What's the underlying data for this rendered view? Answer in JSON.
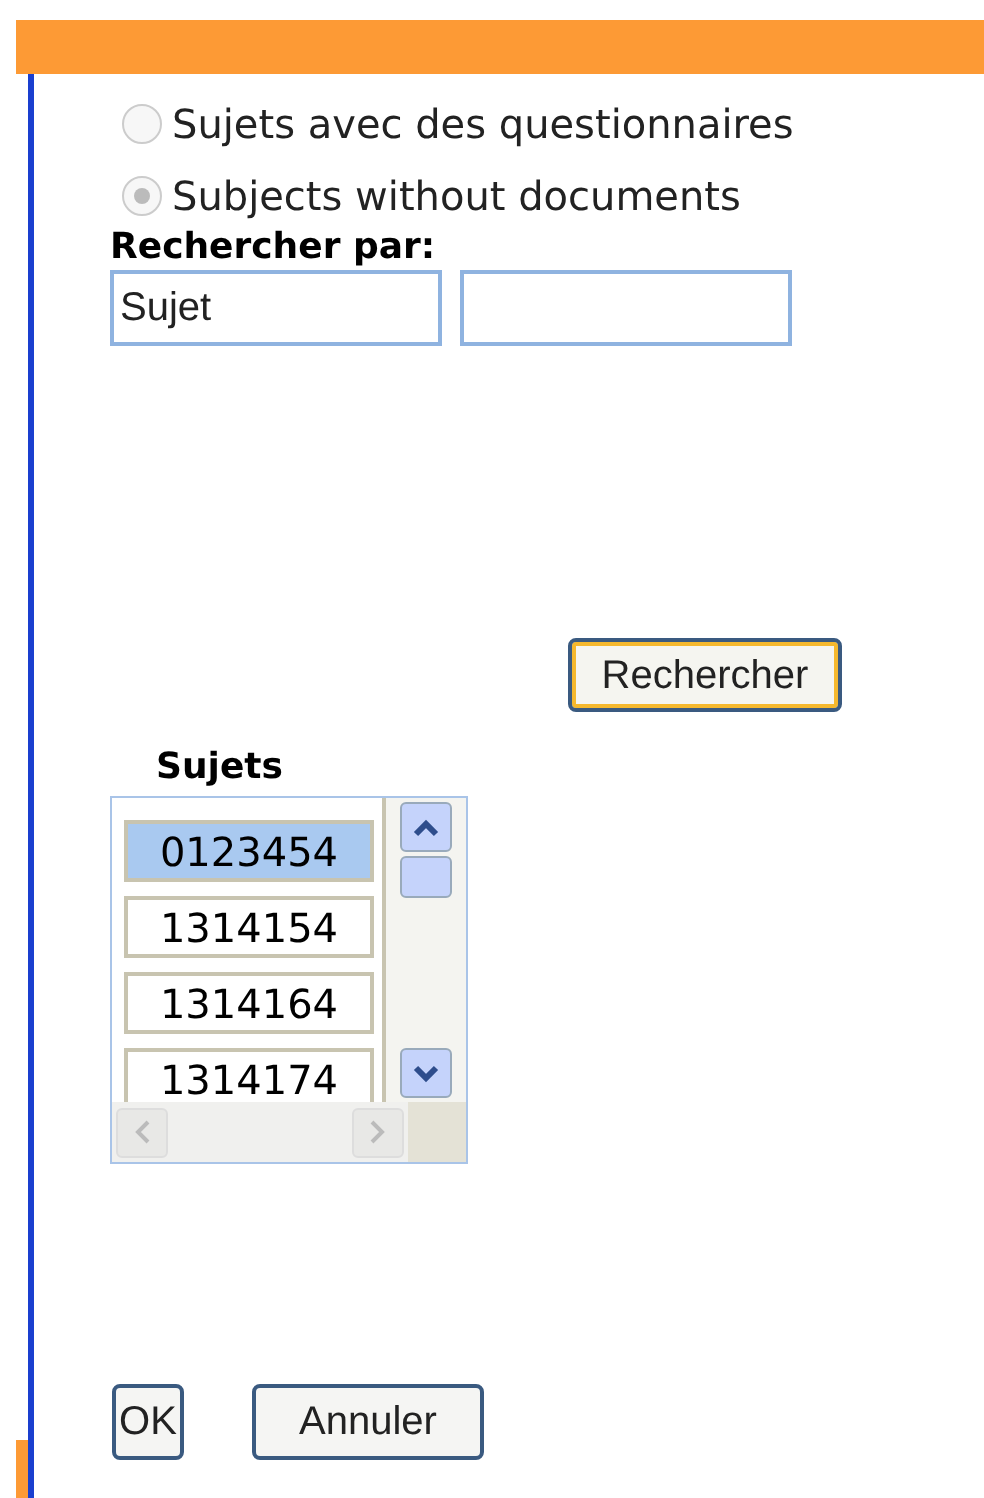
{
  "search_type": [
    {
      "label": "Sujets avec des questionnaires",
      "selected": false
    },
    {
      "label": "Subjects without documents",
      "selected": true
    }
  ],
  "search_by": {
    "label": "Rechercher par:",
    "fields": [
      {
        "kind": "text",
        "value": "Sujet"
      },
      {
        "kind": "text"
      }
    ]
  },
  "search_button": "Rechercher",
  "subjects": {
    "label": "Sujets",
    "items": [
      {
        "text": "0123454",
        "selected": true
      },
      {
        "text": "1314154",
        "selected": false
      },
      {
        "text": "1314164",
        "selected": false
      },
      {
        "text": "1314174",
        "selected": false
      }
    ]
  },
  "buttons": [
    "OK",
    "Annuler"
  ]
}
